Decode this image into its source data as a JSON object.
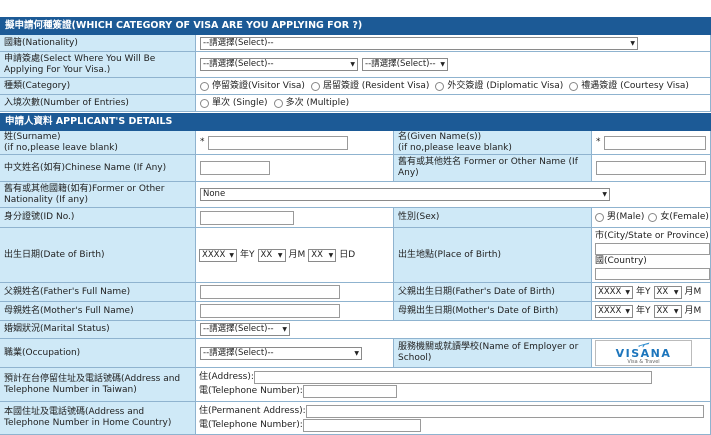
{
  "section1_title": "擬申請何種簽證(WHICH CATEGORY OF VISA ARE YOU APPLYING FOR ?)",
  "section2_title": "申請人資料 APPLICANT'S DETAILS",
  "select_placeholder": "--請選擇(Select)--",
  "nationality_label": "國籍(Nationality)",
  "apply_where_label": "申請簽處(Select Where You Will Be Applying For Your Visa.)",
  "category_label": "種類(Category)",
  "category_options": [
    "停留簽證(Visitor Visa)",
    "居留簽證 (Resident Visa)",
    "外交簽證 (Diplomatic Visa)",
    "禮遇簽證 (Courtesy Visa)"
  ],
  "entries_label": "入境次數(Number of Entries)",
  "entries_options": [
    "單次 (Single)",
    "多次 (Multiple)"
  ],
  "surname_label": "姓(Surname)\n(if no,please leave blank)",
  "given_label": "名(Given Name(s))\n(if no,please leave blank)",
  "required_mark": "*",
  "chinese_name_label": "中文姓名(如有)Chinese Name (If Any)",
  "former_name_label": "舊有或其他姓名 Former or Other Name (If Any)",
  "former_nationality_label": "舊有或其他國籍(如有)Former or Other Nationality (If any)",
  "former_nationality_value": "None",
  "id_label": "身分證號(ID No.)",
  "sex_label": "性別(Sex)",
  "sex_options": [
    "男(Male)",
    "女(Female)"
  ],
  "dob_label": "出生日期(Date of Birth)",
  "date_sel": "XXXX",
  "date_sel2": "XX",
  "year_unit": "年Y",
  "month_unit": "月M",
  "day_unit": "日D",
  "pob_label": "出生地點(Place of Birth)",
  "pob_city": "市(City/State or Province)",
  "pob_country": "國(Country)",
  "father_name_label": "父親姓名(Father's Full Name)",
  "father_dob_label": "父親出生日期(Father's Date of Birth)",
  "mother_name_label": "母親姓名(Mother's Full Name)",
  "mother_dob_label": "母親出生日期(Mother's Date of Birth)",
  "marital_label": "婚姻狀況(Marital Status)",
  "occupation_label": "職業(Occupation)",
  "employer_label": "服務機關或就讀學校(Name of Employer or School)",
  "logo_text": "VISANA",
  "logo_sub": "Visa & Travel",
  "taiwan_addr_label": "預計在台停留住址及電話號碼(Address and Telephone Number in Taiwan)",
  "address_label": "住(Address):",
  "tel_label": "電(Telephone Number):",
  "home_addr_label": "本國住址及電話號碼(Address and Telephone Number in Home Country)",
  "perm_address_label": "住(Permanent Address):",
  "colors": {
    "header": "#1c5a96",
    "label_bg": "#cfe9f7"
  }
}
